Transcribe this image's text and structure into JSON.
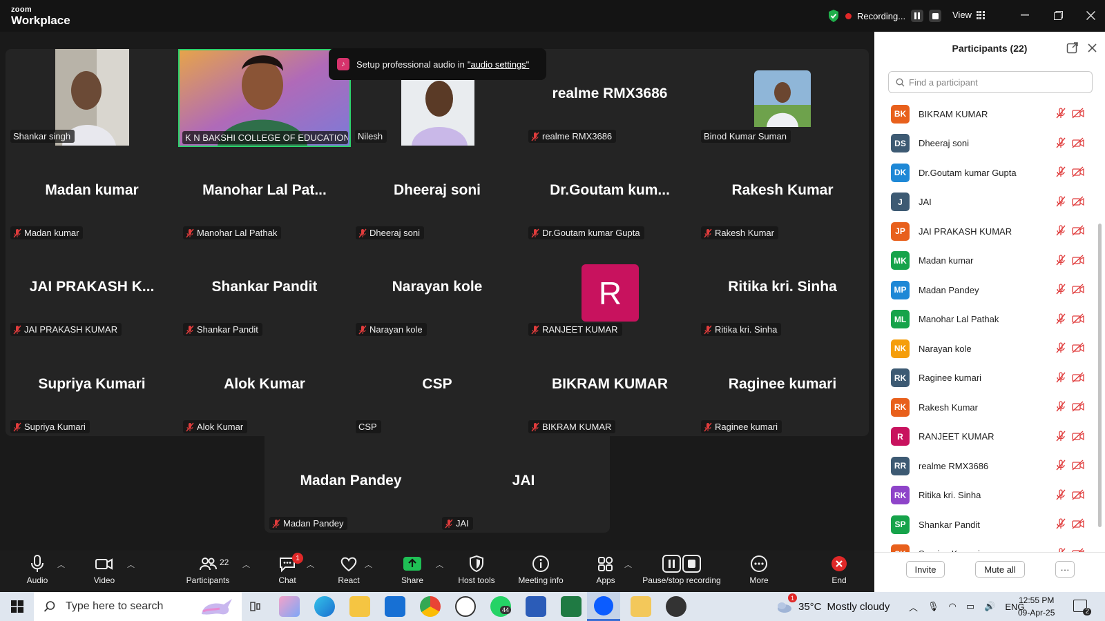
{
  "app": {
    "brand_small": "zoom",
    "brand_large": "Workplace",
    "recording_label": "Recording...",
    "view_label": "View"
  },
  "toast": {
    "text": "Setup professional audio in ",
    "link": "\"audio settings\""
  },
  "tiles": {
    "shankar_singh": "Shankar singh",
    "kn_bakshi": "K N BAKSHI COLLEGE OF EDUCATION K...",
    "nilesh": "Nilesh",
    "realme_big": "realme RMX3686",
    "realme_lbl": "realme RMX3686",
    "binod": "Binod Kumar Suman",
    "madan_big": "Madan kumar",
    "madan_lbl": "Madan kumar",
    "manohar_big": "Manohar Lal Pat...",
    "manohar_lbl": "Manohar Lal Pathak",
    "dheeraj_big": "Dheeraj soni",
    "dheeraj_lbl": "Dheeraj soni",
    "goutam_big": "Dr.Goutam kum...",
    "goutam_lbl": "Dr.Goutam kumar Gupta",
    "rakesh_big": "Rakesh Kumar",
    "rakesh_lbl": "Rakesh Kumar",
    "jai_prakash_big": "JAI PRAKASH K...",
    "jai_prakash_lbl": "JAI PRAKASH KUMAR",
    "shankar_pandit_big": "Shankar Pandit",
    "shankar_pandit_lbl": "Shankar Pandit",
    "narayan_big": "Narayan kole",
    "narayan_lbl": "Narayan kole",
    "ranjeet_avatar": "R",
    "ranjeet_lbl": "RANJEET KUMAR",
    "ritika_big": "Ritika kri. Sinha",
    "ritika_lbl": "Ritika kri. Sinha",
    "supriya_big": "Supriya Kumari",
    "supriya_lbl": "Supriya Kumari",
    "alok_big": "Alok Kumar",
    "alok_lbl": "Alok Kumar",
    "csp_big": "CSP",
    "csp_lbl": "CSP",
    "bikram_big": "BIKRAM KUMAR",
    "bikram_lbl": "BIKRAM KUMAR",
    "raginee_big": "Raginee kumari",
    "raginee_lbl": "Raginee kumari",
    "madan_pandey_big": "Madan Pandey",
    "madan_pandey_lbl": "Madan Pandey",
    "jai_big": "JAI",
    "jai_lbl": "JAI"
  },
  "panel": {
    "title": "Participants (22)",
    "search_placeholder": "Find a participant",
    "participants": [
      {
        "initials": "BK",
        "name": "BIKRAM KUMAR",
        "color": "#e8601c"
      },
      {
        "initials": "DS",
        "name": "Dheeraj soni",
        "color": "#3d5a73"
      },
      {
        "initials": "DK",
        "name": "Dr.Goutam kumar Gupta",
        "color": "#1e88d6"
      },
      {
        "initials": "J",
        "name": "JAI",
        "color": "#3d5a73"
      },
      {
        "initials": "JP",
        "name": "JAI PRAKASH KUMAR",
        "color": "#e8601c"
      },
      {
        "initials": "MK",
        "name": "Madan kumar",
        "color": "#16a34a"
      },
      {
        "initials": "MP",
        "name": "Madan Pandey",
        "color": "#1e88d6"
      },
      {
        "initials": "ML",
        "name": "Manohar Lal Pathak",
        "color": "#16a34a"
      },
      {
        "initials": "NK",
        "name": "Narayan kole",
        "color": "#f59e0b"
      },
      {
        "initials": "RK",
        "name": "Raginee kumari",
        "color": "#3d5a73"
      },
      {
        "initials": "RK",
        "name": "Rakesh Kumar",
        "color": "#e8601c"
      },
      {
        "initials": "R",
        "name": "RANJEET KUMAR",
        "color": "#c8125e"
      },
      {
        "initials": "RR",
        "name": "realme RMX3686",
        "color": "#3d5a73"
      },
      {
        "initials": "RK",
        "name": "Ritika kri. Sinha",
        "color": "#8e44c9"
      },
      {
        "initials": "SP",
        "name": "Shankar Pandit",
        "color": "#16a34a"
      },
      {
        "initials": "SK",
        "name": "Supriya Kumari",
        "color": "#e8601c"
      }
    ],
    "invite": "Invite",
    "mute_all": "Mute all",
    "more": "···"
  },
  "toolbar": {
    "audio": "Audio",
    "video": "Video",
    "participants": "Participants",
    "participants_count": "22",
    "chat": "Chat",
    "chat_badge": "1",
    "react": "React",
    "share": "Share",
    "host_tools": "Host tools",
    "meeting_info": "Meeting info",
    "apps": "Apps",
    "pause_stop": "Pause/stop recording",
    "more": "More",
    "end": "End"
  },
  "taskbar": {
    "search_placeholder": "Type here to search",
    "weather_temp": "35°C",
    "weather_text": "Mostly cloudy",
    "language": "ENG",
    "time": "12:55 PM",
    "date": "09-Apr-25",
    "notif_count": "2",
    "weather_badge": "1",
    "whatsapp_badge": "44"
  }
}
